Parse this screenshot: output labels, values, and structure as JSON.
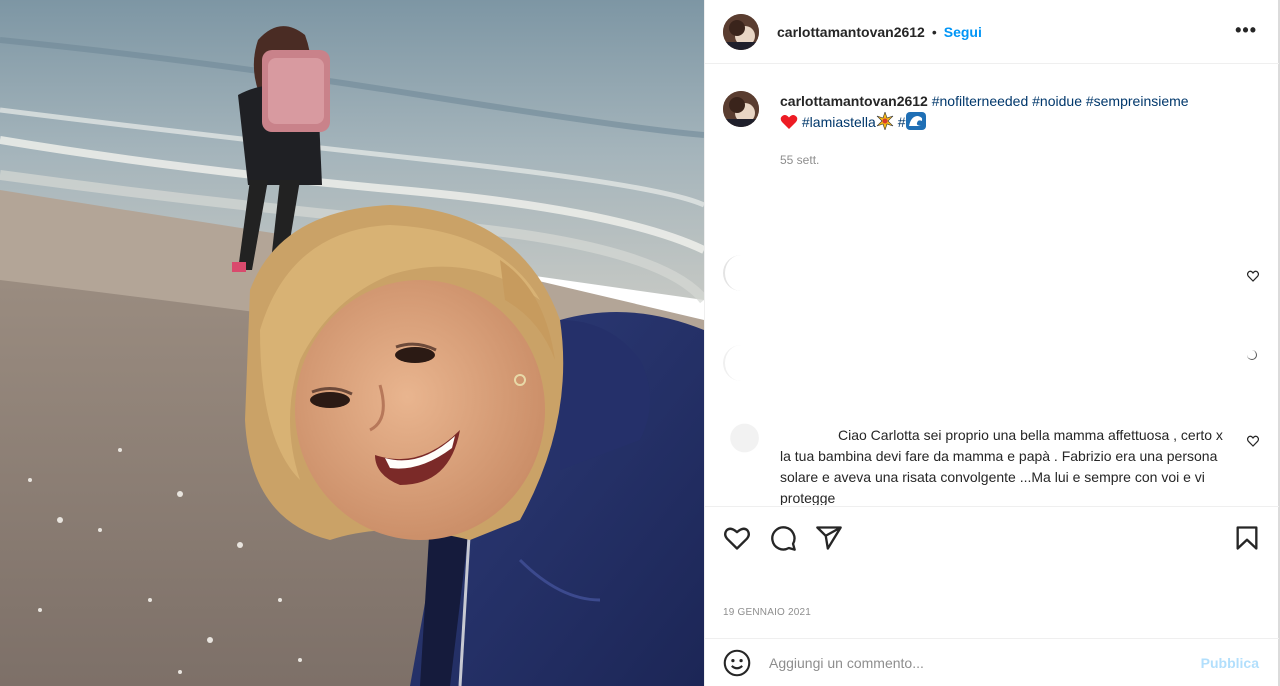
{
  "post": {
    "username": "carlottamantovan2612",
    "separator": "•",
    "follow_label": "Segui",
    "more_label": "•••",
    "caption": {
      "username": "carlottamantovan2612",
      "hashtags_line1": "#nofilterneeded #noidue #sempreinsieme",
      "hashtag_lamiastella": "#lamiastella",
      "hashtag_hash": "#",
      "time_ago": "55 sett."
    },
    "comment": {
      "text_line1": "Ciao Carlotta sei proprio una bella mamma affettuosa ,",
      "text_rest": "certo x la tua bambina devi fare da mamma e papà . Fabrizio era una persona solare e aveva una risata convolgente ...Ma lui e sempre con voi e vi protegge"
    },
    "date": "19 GENNAIO 2021",
    "add_comment": {
      "placeholder": "Aggiungi un commento...",
      "publish_label": "Pubblica"
    }
  },
  "colors": {
    "link_blue": "#0095f6",
    "hashtag": "#00376b",
    "muted": "#8e8e8e",
    "publish_disabled": "#b2dffc",
    "heart_emoji": "#ed1c24"
  },
  "icons": [
    "more-icon",
    "heart-icon",
    "comment-icon",
    "share-icon",
    "bookmark-icon",
    "emoji-icon",
    "heart-small-icon"
  ]
}
